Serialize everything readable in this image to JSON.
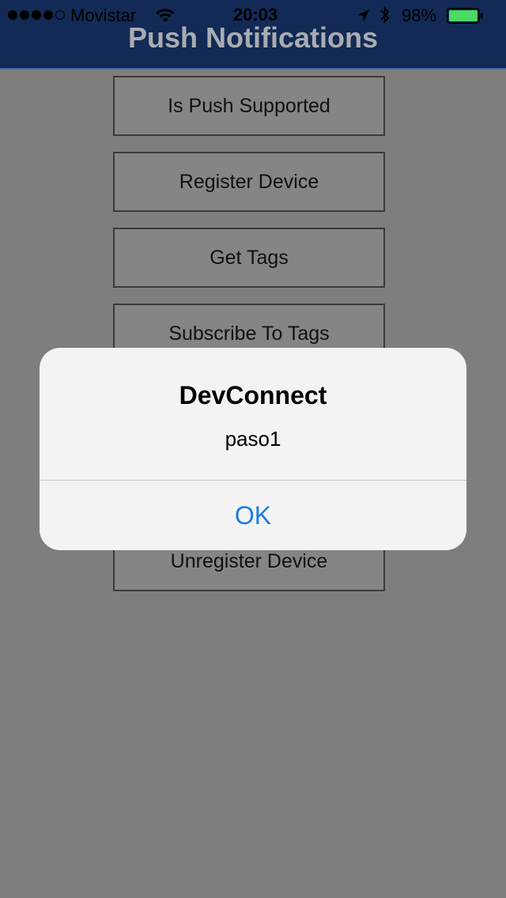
{
  "status_bar": {
    "carrier": "Movistar",
    "time": "20:03",
    "battery_percent": "98%",
    "battery_level": 0.98,
    "battery_color": "#4cd964",
    "signal_strength": 4,
    "icons": [
      "signal-dots",
      "wifi-icon",
      "location-icon",
      "bluetooth-icon",
      "battery-icon"
    ]
  },
  "nav": {
    "title": "Push Notifications"
  },
  "buttons": {
    "is_push_supported": "Is Push Supported",
    "register_device": "Register Device",
    "get_tags": "Get Tags",
    "subscribe_to_tags": "Subscribe To Tags",
    "unregister_device": "Unregister Device"
  },
  "alert": {
    "title": "DevConnect",
    "message": "paso1",
    "ok_label": "OK",
    "ok_color": "#1a7de0"
  },
  "colors": {
    "header": "#122a55",
    "background": "#7e7e7e",
    "button_fill": "#858585"
  }
}
